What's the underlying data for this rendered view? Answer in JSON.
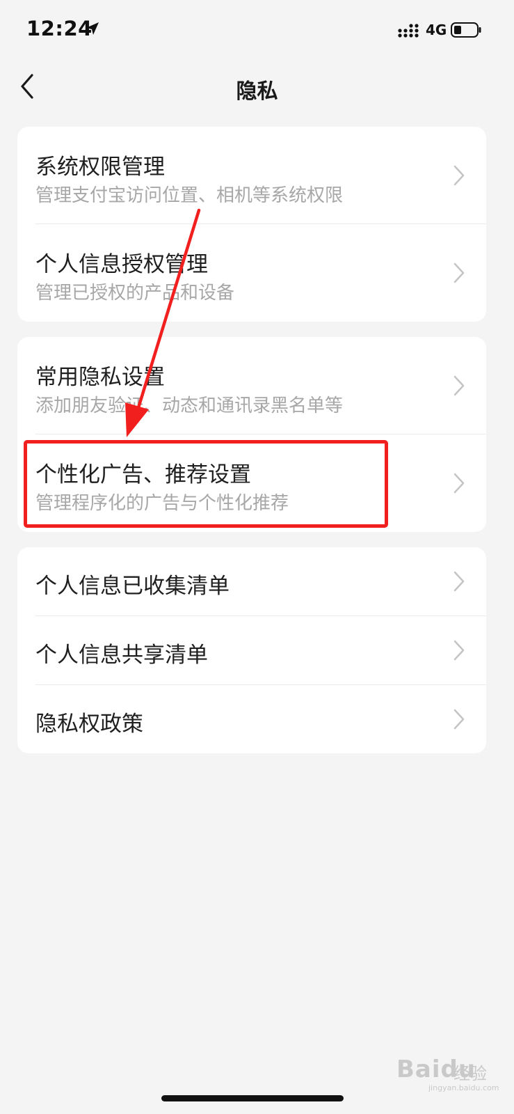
{
  "status_bar": {
    "time": "12:24",
    "network": "4G"
  },
  "nav": {
    "title": "隐私",
    "back_icon": "chevron-left-icon"
  },
  "groups": [
    {
      "items": [
        {
          "title": "系统权限管理",
          "subtitle": "管理支付宝访问位置、相机等系统权限"
        },
        {
          "title": "个人信息授权管理",
          "subtitle": "管理已授权的产品和设备"
        }
      ]
    },
    {
      "items": [
        {
          "title": "常用隐私设置",
          "subtitle": "添加朋友验证、动态和通讯录黑名单等"
        },
        {
          "title": "个性化广告、推荐设置",
          "subtitle": "管理程序化的广告与个性化推荐",
          "highlighted": true
        }
      ]
    },
    {
      "items": [
        {
          "title": "个人信息已收集清单"
        },
        {
          "title": "个人信息共享清单"
        },
        {
          "title": "隐私权政策"
        }
      ]
    }
  ],
  "annotation": {
    "highlight_color": "#f21f1f",
    "arrow_color": "#f21f1f"
  },
  "watermark": {
    "brand": "Baidu",
    "brand_cn": "经验",
    "url": "jingyan.baidu.com"
  },
  "colors": {
    "background": "#f4f4f4",
    "card": "#ffffff",
    "title": "#1f1f1f",
    "subtitle": "#a7a7a7"
  }
}
